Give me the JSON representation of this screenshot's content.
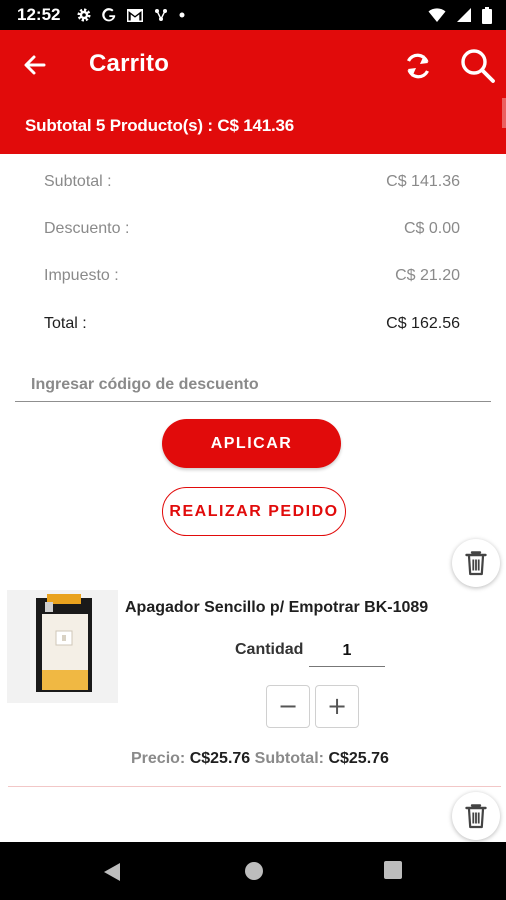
{
  "status_bar": {
    "time": "12:52",
    "icons": [
      "gear-icon",
      "google-icon",
      "gmail-icon",
      "network-icon",
      "dot-icon",
      "wifi-icon",
      "signal-icon",
      "battery-icon"
    ]
  },
  "header": {
    "title": "Carrito",
    "subtotal_summary": "Subtotal 5 Producto(s) : C$ 141.36",
    "accent_color": "#e10b0b",
    "icons": [
      "back-arrow-icon",
      "refresh-icon",
      "search-icon"
    ]
  },
  "totals": {
    "subtotal": {
      "label": "Subtotal :",
      "value": "C$ 141.36"
    },
    "discount": {
      "label": "Descuento :",
      "value": "C$ 0.00"
    },
    "tax": {
      "label": "Impuesto :",
      "value": "C$ 21.20"
    },
    "total": {
      "label": "Total :",
      "value": "C$ 162.56"
    }
  },
  "discount_code": {
    "placeholder": "Ingresar código de descuento",
    "value": ""
  },
  "actions": {
    "apply_label": "APLICAR",
    "place_order_label": "REALIZAR PEDIDO"
  },
  "cart_items": [
    {
      "name": "Apagador Sencillo p/ Empotrar BK-1089",
      "quantity_label": "Cantidad",
      "quantity": "1",
      "minus_label": "−",
      "plus_label": "+",
      "price_label": "Precio:",
      "price": "C$25.76",
      "subtotal_label": "Subtotal:",
      "subtotal": "C$25.76"
    }
  ],
  "nav_bar": {
    "icons": [
      "back-triangle-icon",
      "home-circle-icon",
      "recents-square-icon"
    ]
  }
}
